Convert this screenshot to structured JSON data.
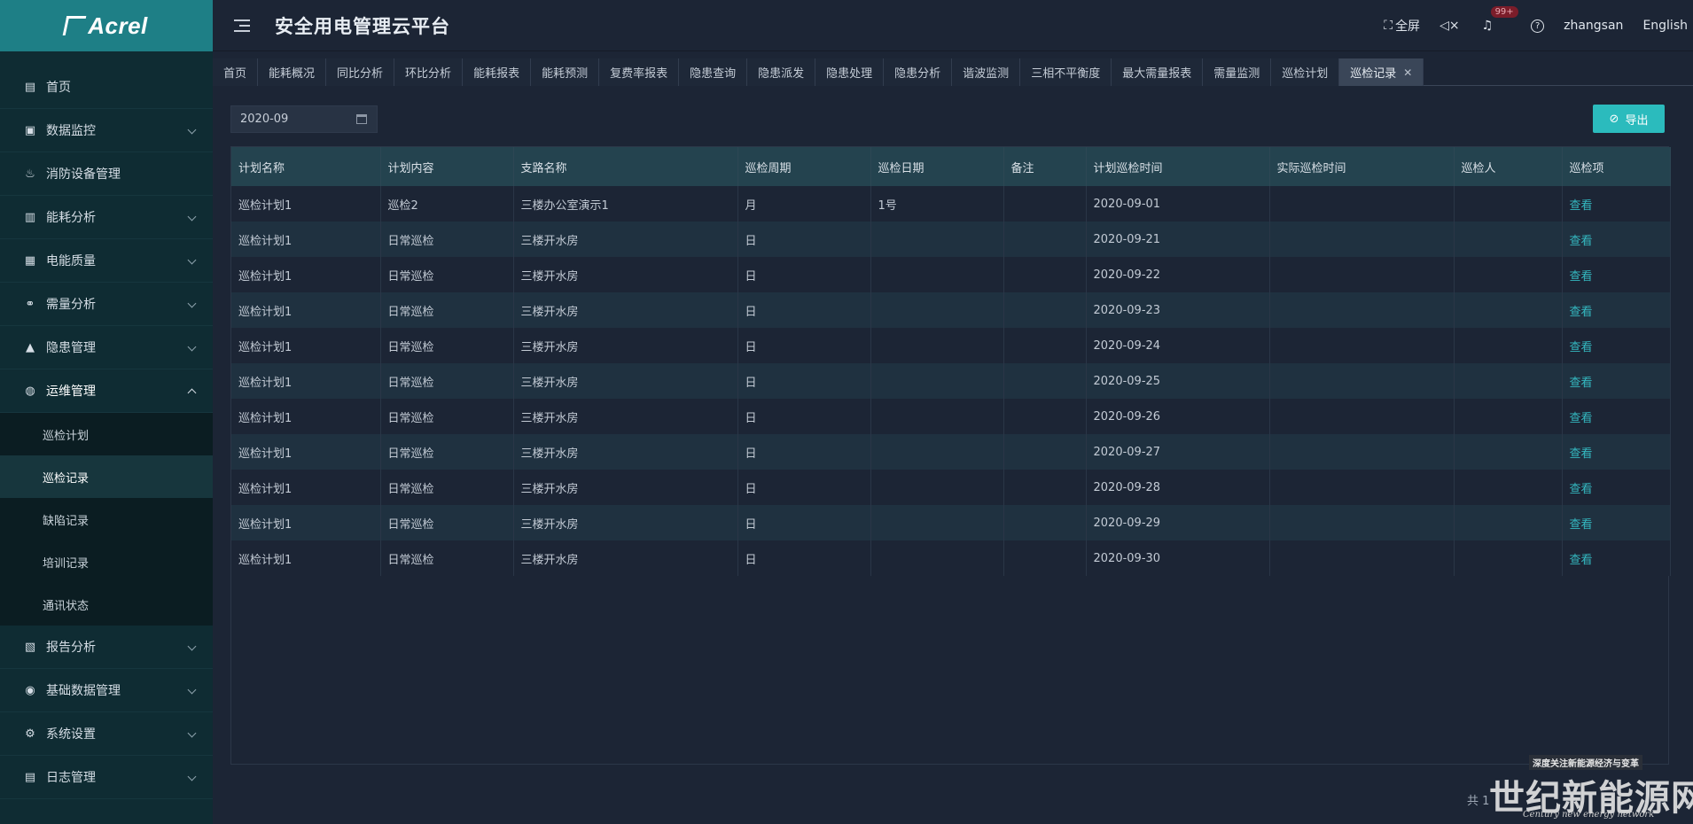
{
  "brand": {
    "logo_text": "Acrel"
  },
  "header": {
    "title": "安全用电管理云平台",
    "fullscreen": "全屏",
    "badge": "99+",
    "username": "zhangsan",
    "language": "English"
  },
  "sidebar": {
    "items": [
      {
        "label": "首页",
        "icon": "home-icon"
      },
      {
        "label": "数据监控",
        "icon": "monitor-icon"
      },
      {
        "label": "消防设备管理",
        "icon": "extinguisher-icon"
      },
      {
        "label": "能耗分析",
        "icon": "bar-chart-icon"
      },
      {
        "label": "电能质量",
        "icon": "calendar-plug-icon"
      },
      {
        "label": "需量分析",
        "icon": "nodes-icon"
      },
      {
        "label": "隐患管理",
        "icon": "warning-icon"
      },
      {
        "label": "运维管理",
        "icon": "maintenance-icon"
      }
    ],
    "subitems": [
      "巡检计划",
      "巡检记录",
      "缺陷记录",
      "培训记录",
      "通讯状态"
    ],
    "items_after": [
      {
        "label": "报告分析",
        "icon": "report-icon"
      },
      {
        "label": "基础数据管理",
        "icon": "database-icon"
      },
      {
        "label": "系统设置",
        "icon": "settings-icon"
      },
      {
        "label": "日志管理",
        "icon": "log-icon"
      }
    ]
  },
  "tabs": [
    "首页",
    "能耗概况",
    "同比分析",
    "环比分析",
    "能耗报表",
    "能耗预测",
    "复费率报表",
    "隐患查询",
    "隐患派发",
    "隐患处理",
    "隐患分析",
    "谐波监测",
    "三相不平衡度",
    "最大需量报表",
    "需量监测",
    "巡检计划",
    "巡检记录"
  ],
  "filter": {
    "date": "2020-09"
  },
  "export_label": "导出",
  "table": {
    "columns": [
      "计划名称",
      "计划内容",
      "支路名称",
      "巡检周期",
      "巡检日期",
      "备注",
      "计划巡检时间",
      "实际巡检时间",
      "巡检人",
      "巡检项"
    ],
    "rows": [
      [
        "巡检计划1",
        "巡检2",
        "三楼办公室演示1",
        "月",
        "1号",
        "",
        "2020-09-01",
        "",
        "",
        "查看"
      ],
      [
        "巡检计划1",
        "日常巡检",
        "三楼开水房",
        "日",
        "",
        "",
        "2020-09-21",
        "",
        "",
        "查看"
      ],
      [
        "巡检计划1",
        "日常巡检",
        "三楼开水房",
        "日",
        "",
        "",
        "2020-09-22",
        "",
        "",
        "查看"
      ],
      [
        "巡检计划1",
        "日常巡检",
        "三楼开水房",
        "日",
        "",
        "",
        "2020-09-23",
        "",
        "",
        "查看"
      ],
      [
        "巡检计划1",
        "日常巡检",
        "三楼开水房",
        "日",
        "",
        "",
        "2020-09-24",
        "",
        "",
        "查看"
      ],
      [
        "巡检计划1",
        "日常巡检",
        "三楼开水房",
        "日",
        "",
        "",
        "2020-09-25",
        "",
        "",
        "查看"
      ],
      [
        "巡检计划1",
        "日常巡检",
        "三楼开水房",
        "日",
        "",
        "",
        "2020-09-26",
        "",
        "",
        "查看"
      ],
      [
        "巡检计划1",
        "日常巡检",
        "三楼开水房",
        "日",
        "",
        "",
        "2020-09-27",
        "",
        "",
        "查看"
      ],
      [
        "巡检计划1",
        "日常巡检",
        "三楼开水房",
        "日",
        "",
        "",
        "2020-09-28",
        "",
        "",
        "查看"
      ],
      [
        "巡检计划1",
        "日常巡检",
        "三楼开水房",
        "日",
        "",
        "",
        "2020-09-29",
        "",
        "",
        "查看"
      ],
      [
        "巡检计划1",
        "日常巡检",
        "三楼开水房",
        "日",
        "",
        "",
        "2020-09-30",
        "",
        "",
        "查看"
      ]
    ]
  },
  "pager": {
    "text": "共 1"
  },
  "watermark": {
    "top": "深度关注新能源经济与变革",
    "main": "世纪新能源网",
    "sub": "Century new energy network"
  },
  "colors": {
    "accent": "#2bbbbd",
    "logo_bg": "#1e7f86",
    "sidebar_bg": "#0f2c33"
  }
}
